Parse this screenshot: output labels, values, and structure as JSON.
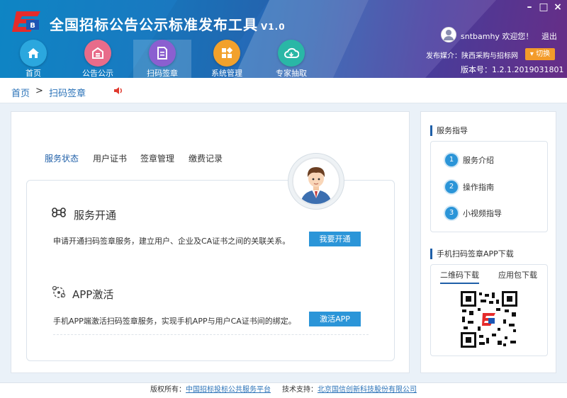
{
  "app": {
    "title": "全国招标公告公示标准发布工具",
    "version_label": "V1.0"
  },
  "window_controls": {
    "minimize": "–",
    "maximize": "□",
    "close": "×"
  },
  "nav": [
    {
      "label": "首页",
      "icon": "home-icon",
      "color": "#2ba7de"
    },
    {
      "label": "公告公示",
      "icon": "bulletin-icon",
      "color": "#e86c8a"
    },
    {
      "label": "扫码签章",
      "icon": "document-icon",
      "color": "#8b5fd0"
    },
    {
      "label": "系统管理",
      "icon": "grid-icon",
      "color": "#f2a12c"
    },
    {
      "label": "专家抽取",
      "icon": "cloud-icon",
      "color": "#2ab7a6"
    }
  ],
  "user": {
    "name": "sntbamhy",
    "welcome": "欢迎您！",
    "logout": "退出",
    "media": "发布媒介：陕西采购与招标网",
    "switch": "切换",
    "version": "版本号：1.2.1.2019031801"
  },
  "breadcrumb": {
    "home": "首页",
    "sep": ">",
    "current": "扫码签章"
  },
  "tabs": [
    "服务状态",
    "用户证书",
    "签章管理",
    "缴费记录"
  ],
  "services": {
    "open": {
      "title": "服务开通",
      "desc": "申请开通扫码签章服务，建立用户、企业及CA证书之间的关联关系。",
      "button": "我要开通"
    },
    "app": {
      "title": "APP激活",
      "desc": "手机APP端激活扫码签章服务，实现手机APP与用户CA证书间的绑定。",
      "button": "激活APP"
    }
  },
  "guide": {
    "title": "服务指导",
    "items": [
      {
        "num": "1",
        "label": "服务介绍"
      },
      {
        "num": "2",
        "label": "操作指南"
      },
      {
        "num": "3",
        "label": "小视频指导"
      }
    ]
  },
  "download": {
    "title": "手机扫码签章APP下载",
    "tabs": [
      "二维码下载",
      "应用包下载"
    ]
  },
  "footer": {
    "copyright_label": "版权所有：",
    "copyright_org": "中国招标投标公共服务平台",
    "support_label": "技术支持：",
    "support_org": "北京国信创新科技股份有限公司"
  },
  "colors": {
    "accent": "#1f5fa8",
    "button": "#2b95d8",
    "switch": "#f39b2a"
  }
}
